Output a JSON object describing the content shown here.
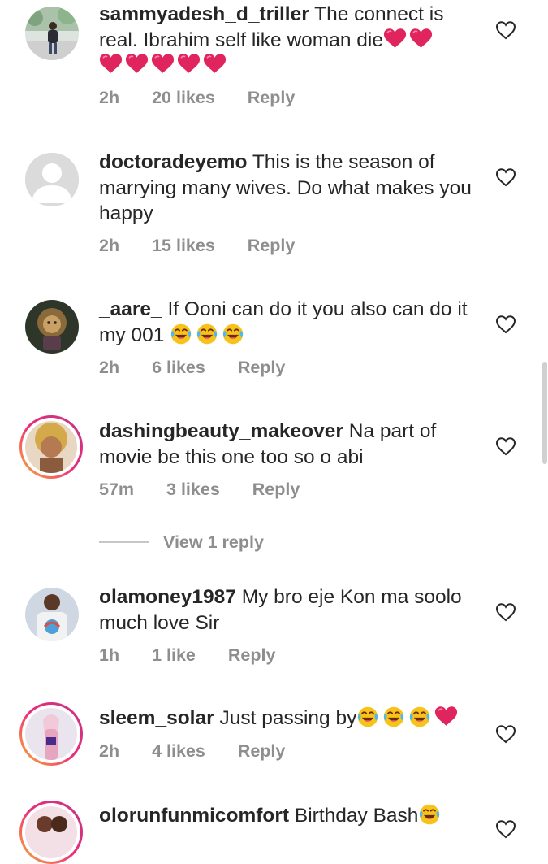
{
  "comments": [
    {
      "username": "sammyadesh_d_triller",
      "text": "The connect is real. Ibrahim self like woman die",
      "emoji": [
        "red-heart",
        "red-heart",
        "red-heart",
        "red-heart",
        "red-heart",
        "red-heart",
        "red-heart"
      ],
      "time": "2h",
      "likes": "20 likes",
      "reply": "Reply",
      "avatar": "person-outdoors-photo"
    },
    {
      "username": "doctoradeyemo",
      "text": "This is the season of marrying many wives. Do what makes you happy",
      "emoji": [],
      "time": "2h",
      "likes": "15 likes",
      "reply": "Reply",
      "avatar": "default-profile-placeholder"
    },
    {
      "username": "_aare_",
      "text": "If Ooni can do it you also can do it my 001",
      "emoji": [
        "tears-of-joy",
        "tears-of-joy",
        "tears-of-joy"
      ],
      "time": "2h",
      "likes": "6 likes",
      "reply": "Reply",
      "avatar": "lion-illustration"
    },
    {
      "username": "dashingbeauty_makeover",
      "text": "Na part of movie be this one too so o abi",
      "emoji": [],
      "time": "57m",
      "likes": "3 likes",
      "reply": "Reply",
      "avatar": "woman-portrait-with-story-ring"
    },
    {
      "username": "olamoney1987",
      "text": "My bro eje Kon ma soolo much love Sir",
      "emoji": [],
      "time": "1h",
      "likes": "1 like",
      "reply": "Reply",
      "avatar": "man-with-printed-shirt"
    },
    {
      "username": "sleem_solar",
      "text": "Just passing by",
      "emoji": [
        "tears-of-joy",
        "tears-of-joy",
        "tears-of-joy",
        "red-heart"
      ],
      "time": "2h",
      "likes": "4 likes",
      "reply": "Reply",
      "avatar": "woman-with-story-ring"
    },
    {
      "username": "olorunfunmicomfort",
      "text": "Birthday Bash",
      "emoji": [
        "tears-of-joy"
      ],
      "avatar": "couple-with-story-ring"
    }
  ],
  "view_replies": "View 1 reply",
  "colors": {
    "text": "#262626",
    "muted": "#8e8e8e",
    "heart_emoji": "#e0245e",
    "story_ring_start": "#f9b233",
    "story_ring_end": "#c13584"
  }
}
